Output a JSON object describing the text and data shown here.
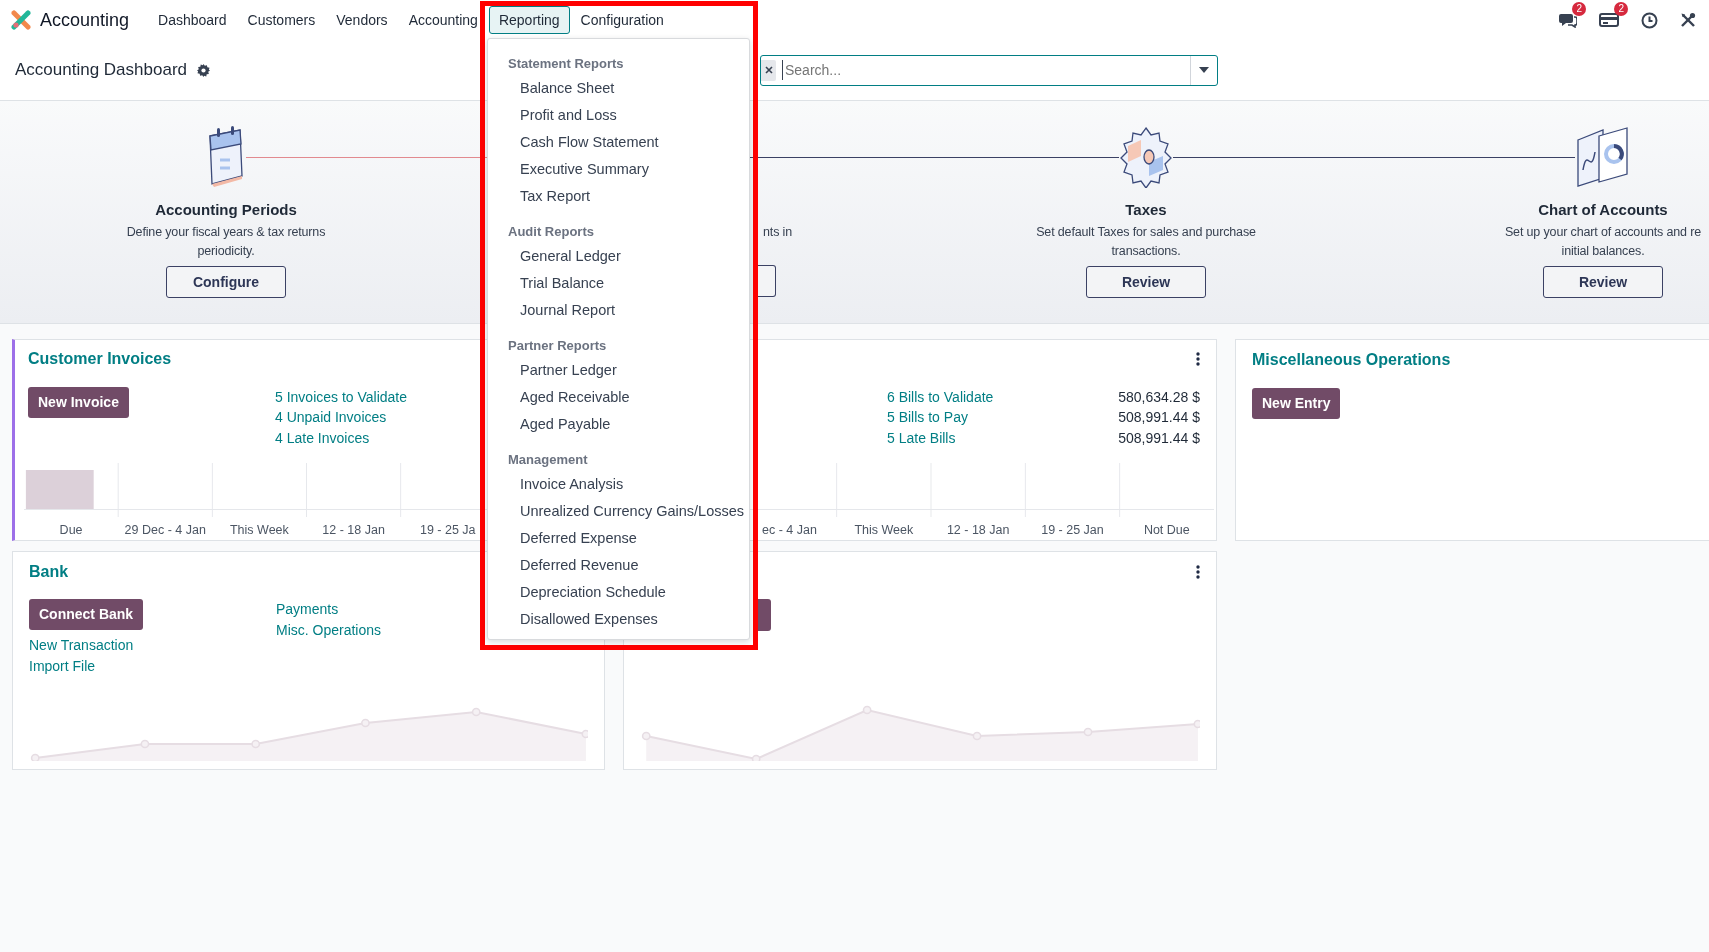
{
  "navbar": {
    "app_name": "Accounting",
    "menu": [
      {
        "label": "Dashboard",
        "selected": false
      },
      {
        "label": "Customers",
        "selected": false
      },
      {
        "label": "Vendors",
        "selected": false
      },
      {
        "label": "Accounting",
        "selected": false
      },
      {
        "label": "Reporting",
        "selected": true
      },
      {
        "label": "Configuration",
        "selected": false
      }
    ],
    "systray": [
      {
        "kind": "chat",
        "badge": "2"
      },
      {
        "kind": "activity",
        "badge": "2"
      },
      {
        "kind": "clock"
      },
      {
        "kind": "tools"
      }
    ]
  },
  "control_panel": {
    "title": "Accounting Dashboard",
    "search": {
      "placeholder": "Search..."
    }
  },
  "onboarding": [
    {
      "kind": "calendar",
      "title": "Accounting Periods",
      "description": [
        "Define your fiscal years & tax returns",
        "periodicity."
      ],
      "button": "Configure",
      "done": true
    },
    {
      "kind": "covered",
      "description": [
        "nts in"
      ],
      "done": false
    },
    {
      "kind": "gear",
      "title": "Taxes",
      "description": [
        "Set default Taxes for sales and purchase",
        "transactions."
      ],
      "button": "Review",
      "done": false
    },
    {
      "kind": "document",
      "title": "Chart of Accounts",
      "description": [
        "Set up your chart of accounts and re",
        "initial balances."
      ],
      "button": "Review"
    }
  ],
  "journals": [
    {
      "kind": "sale",
      "title": "Customer Invoices",
      "color": "#9d6fe8",
      "button": "New Invoice",
      "links": [
        {
          "label": "5 Invoices to Validate"
        },
        {
          "label": "4 Unpaid Invoices"
        },
        {
          "label": "4 Late Invoices"
        }
      ],
      "chart_labels": [
        "Due",
        "29 Dec - 4 Jan",
        "This Week",
        "12 - 18 Jan",
        "19 - 25 Ja"
      ]
    },
    {
      "kind": "purchase",
      "links": [
        {
          "label": "6 Bills to Validate",
          "amount": "580,634.28 $"
        },
        {
          "label": "5 Bills to Pay",
          "amount": "508,991.44 $"
        },
        {
          "label": "5 Late Bills",
          "amount": "508,991.44 $"
        }
      ],
      "chart_labels": [
        "ec - 4 Jan",
        "This Week",
        "12 - 18 Jan",
        "19 - 25 Jan",
        "Not Due"
      ]
    },
    {
      "kind": "general",
      "title": "Miscellaneous Operations",
      "button": "New Entry"
    },
    {
      "kind": "bank",
      "title": "Bank",
      "button": "Connect Bank",
      "left_links": [
        "New Transaction",
        "Import File"
      ],
      "links": [
        {
          "label": "Payments"
        },
        {
          "label": "Misc. Operations"
        }
      ]
    },
    {
      "kind": "covered-bank"
    }
  ],
  "reporting_menu": {
    "sections": [
      {
        "title": "Statement Reports",
        "items": [
          "Balance Sheet",
          "Profit and Loss",
          "Cash Flow Statement",
          "Executive Summary",
          "Tax Report"
        ]
      },
      {
        "title": "Audit Reports",
        "items": [
          "General Ledger",
          "Trial Balance",
          "Journal Report"
        ]
      },
      {
        "title": "Partner Reports",
        "items": [
          "Partner Ledger",
          "Aged Receivable",
          "Aged Payable"
        ]
      },
      {
        "title": "Management",
        "items": [
          "Invoice Analysis",
          "Unrealized Currency Gains/Losses",
          "Deferred Expense",
          "Deferred Revenue",
          "Depreciation Schedule",
          "Disallowed Expenses"
        ]
      }
    ]
  }
}
